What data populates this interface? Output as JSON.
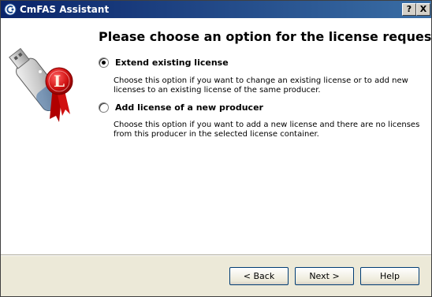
{
  "window": {
    "title": "CmFAS Assistant",
    "help_button": "?",
    "close_button": "X"
  },
  "page": {
    "heading": "Please choose an option for the license request"
  },
  "options": [
    {
      "label": "Extend existing license",
      "selected": true,
      "description": "Choose this option if you want to change an existing license or to add new licenses to an existing license of the same producer."
    },
    {
      "label": "Add license of a new producer",
      "selected": false,
      "description": "Choose this option if you want to add a new license and there are no licenses from this producer in the selected license container."
    }
  ],
  "buttons": {
    "back": "< Back",
    "next": "Next >",
    "help": "Help"
  },
  "colors": {
    "titlebar_start": "#0a246a",
    "titlebar_end": "#3a6ea5",
    "content_bg": "#ffffff",
    "frame_bg": "#ece9d8",
    "accent_red": "#d01010"
  }
}
